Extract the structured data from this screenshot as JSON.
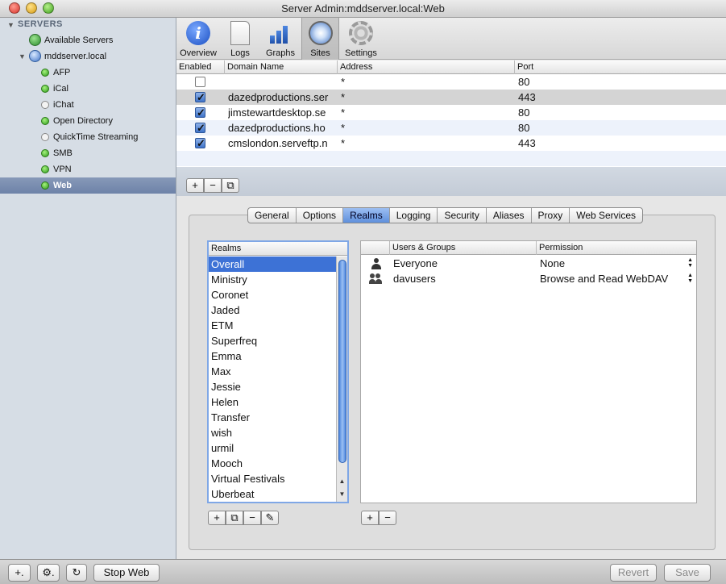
{
  "window": {
    "title": "Server Admin:mddserver.local:Web"
  },
  "sidebar": {
    "header": "SERVERS",
    "available_servers": "Available Servers",
    "server": "mddserver.local",
    "services": [
      {
        "label": "AFP",
        "status": "on"
      },
      {
        "label": "iCal",
        "status": "on"
      },
      {
        "label": "iChat",
        "status": "off"
      },
      {
        "label": "Open Directory",
        "status": "on"
      },
      {
        "label": "QuickTime Streaming",
        "status": "off"
      },
      {
        "label": "SMB",
        "status": "on"
      },
      {
        "label": "VPN",
        "status": "on"
      },
      {
        "label": "Web",
        "status": "on",
        "selected": true
      }
    ]
  },
  "toolbar": {
    "overview": "Overview",
    "logs": "Logs",
    "graphs": "Graphs",
    "sites": "Sites",
    "settings": "Settings",
    "active": "sites"
  },
  "sites_table": {
    "headers": {
      "enabled": "Enabled",
      "domain": "Domain Name",
      "address": "Address",
      "port": "Port"
    },
    "rows": [
      {
        "enabled": false,
        "domain": "",
        "address": "*",
        "port": "80"
      },
      {
        "enabled": true,
        "domain": "dazedproductions.ser",
        "address": "*",
        "port": "443"
      },
      {
        "enabled": true,
        "domain": "jimstewartdesktop.se",
        "address": "*",
        "port": "80"
      },
      {
        "enabled": true,
        "domain": "dazedproductions.ho",
        "address": "*",
        "port": "80"
      },
      {
        "enabled": true,
        "domain": "cmslondon.serveftp.n",
        "address": "*",
        "port": "443"
      }
    ],
    "buttons": {
      "add": "+",
      "remove": "−",
      "duplicate": "⧉"
    }
  },
  "tabs": [
    "General",
    "Options",
    "Realms",
    "Logging",
    "Security",
    "Aliases",
    "Proxy",
    "Web Services"
  ],
  "active_tab": "Realms",
  "realms": {
    "header": "Realms",
    "items": [
      "Overall",
      "Ministry",
      "Coronet",
      "Jaded",
      "ETM",
      "Superfreq",
      "Emma",
      "Max",
      "Jessie",
      "Helen",
      "Transfer",
      "wish",
      "urmil",
      "Mooch",
      "Virtual Festivals",
      "Uberbeat"
    ],
    "buttons": {
      "add": "+",
      "duplicate": "⧉",
      "remove": "−",
      "edit": "✎"
    }
  },
  "users": {
    "headers": {
      "users": "Users & Groups",
      "permission": "Permission"
    },
    "rows": [
      {
        "name": "Everyone",
        "permission": "None",
        "icon": "person-icon"
      },
      {
        "name": "davusers",
        "permission": "Browse and Read WebDAV",
        "icon": "group-icon"
      }
    ],
    "buttons": {
      "add": "+",
      "remove": "−"
    }
  },
  "bottombar": {
    "add": "+.",
    "action": "⚙.",
    "refresh": "↻",
    "stop": "Stop Web",
    "revert": "Revert",
    "save": "Save"
  }
}
